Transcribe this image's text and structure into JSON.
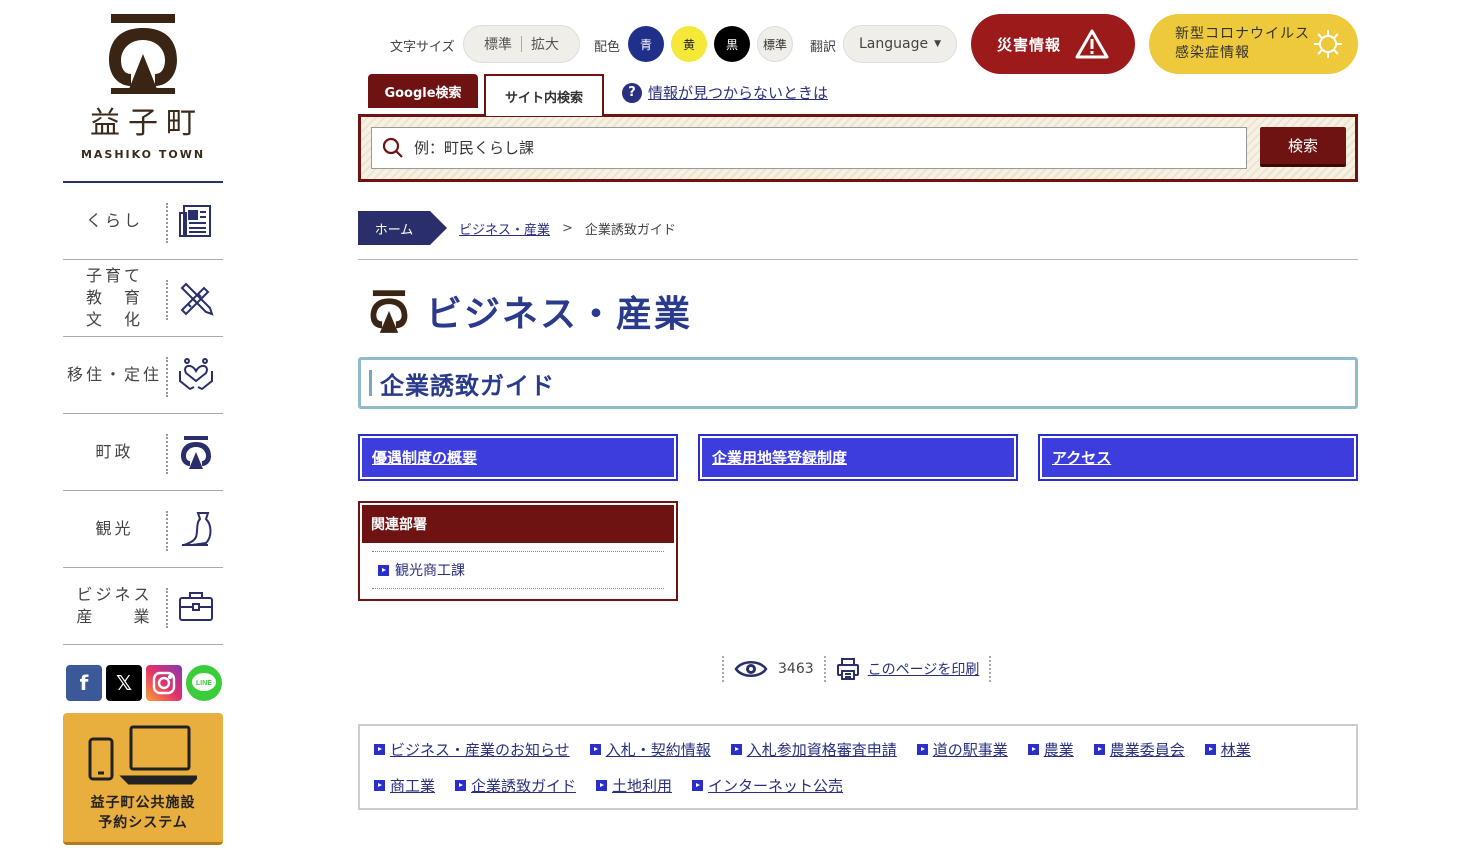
{
  "logo": {
    "name": "益子町",
    "sub": "MASHIKO TOWN"
  },
  "sidebar": {
    "items": [
      {
        "label": "くらし",
        "icon": "newspaper-icon"
      },
      {
        "label": "子育て\n教　育\n文　化",
        "icon": "pencil-ruler-icon"
      },
      {
        "label": "移住・定住",
        "icon": "hands-heart-icon"
      },
      {
        "label": "町政",
        "icon": "town-emblem-icon"
      },
      {
        "label": "観光",
        "icon": "vase-icon"
      },
      {
        "label": "ビジネス\n産　　業",
        "icon": "briefcase-icon"
      }
    ],
    "social": [
      "facebook-icon",
      "x-icon",
      "instagram-icon",
      "line-icon"
    ],
    "booking_label": "益子町公共施設\n予約システム"
  },
  "topbar": {
    "fontsize_label": "文字サイズ",
    "fontsize_standard": "標準",
    "fontsize_large": "拡大",
    "color_label": "配色",
    "color_blue": "青",
    "color_yellow": "黄",
    "color_black": "黒",
    "color_standard": "標準",
    "translate_label": "翻訳",
    "language": "Language",
    "disaster": "災害情報",
    "corona": "新型コロナウイルス\n感染症情報"
  },
  "search": {
    "tab_google": "Google検索",
    "tab_site": "サイト内検索",
    "help": "情報が見つからないときは",
    "placeholder": "例：町民くらし課",
    "button": "検索"
  },
  "breadcrumb": {
    "home": "ホーム",
    "category": "ビジネス・産業",
    "separator": ">",
    "current": "企業誘致ガイド"
  },
  "category_title": "ビジネス・産業",
  "page_title": "企業誘致ガイド",
  "link_buttons": [
    "優遇制度の概要",
    "企業用地等登録制度",
    "アクセス"
  ],
  "related": {
    "heading": "関連部署",
    "link": "観光商工課"
  },
  "page_tools": {
    "views": "3463",
    "print": "このページを印刷"
  },
  "footer_links": [
    "ビジネス・産業のお知らせ",
    "入札・契約情報",
    "入札参加資格審査申請",
    "道の駅事業",
    "農業",
    "農業委員会",
    "林業",
    "商工業",
    "企業誘致ガイド",
    "土地利用",
    "インターネット公売"
  ],
  "colors": {
    "navy": "#2a2f6b",
    "maroon": "#6e1212",
    "link_blue": "#3d3ddd",
    "disaster_red": "#9c1a1a",
    "corona_yellow": "#efc93c",
    "booking_orange": "#e8ae3e"
  }
}
